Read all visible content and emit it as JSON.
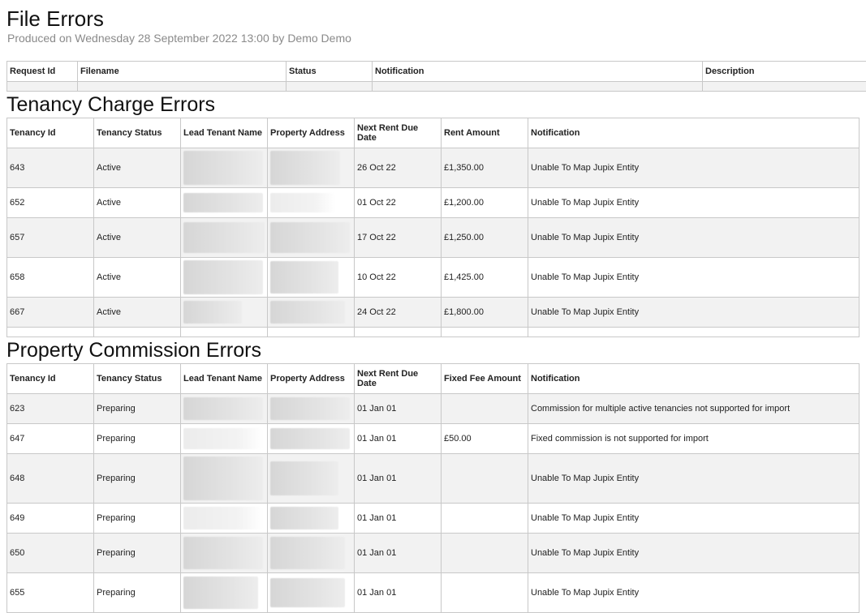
{
  "page": {
    "title": "File Errors",
    "subtitle": "Produced on Wednesday 28 September 2022 13:00 by Demo Demo"
  },
  "file_errors": {
    "columns": [
      "Request Id",
      "Filename",
      "Status",
      "Notification",
      "Description"
    ]
  },
  "tenancy_charge": {
    "title": "Tenancy Charge Errors",
    "columns": [
      "Tenancy Id",
      "Tenancy Status",
      "Lead Tenant Name",
      "Property Address",
      "Next Rent Due Date",
      "Rent Amount",
      "Notification"
    ],
    "rows": [
      {
        "id": "643",
        "status": "Active",
        "due": "26 Oct 22",
        "amount": "£1,350.00",
        "notification": "Unable To Map Jupix Entity"
      },
      {
        "id": "652",
        "status": "Active",
        "due": "01 Oct 22",
        "amount": "£1,200.00",
        "notification": "Unable To Map Jupix Entity"
      },
      {
        "id": "657",
        "status": "Active",
        "due": "17 Oct 22",
        "amount": "£1,250.00",
        "notification": "Unable To Map Jupix Entity"
      },
      {
        "id": "658",
        "status": "Active",
        "due": "10 Oct 22",
        "amount": "£1,425.00",
        "notification": "Unable To Map Jupix Entity"
      },
      {
        "id": "667",
        "status": "Active",
        "due": "24 Oct 22",
        "amount": "£1,800.00",
        "notification": "Unable To Map Jupix Entity"
      }
    ]
  },
  "property_commission": {
    "title": "Property Commission Errors",
    "columns": [
      "Tenancy Id",
      "Tenancy Status",
      "Lead Tenant Name",
      "Property Address",
      "Next Rent Due Date",
      "Fixed Fee Amount",
      "Notification"
    ],
    "rows": [
      {
        "id": "623",
        "status": "Preparing",
        "due": "01 Jan 01",
        "amount": "",
        "notification": "Commission for multiple active tenancies not supported for import"
      },
      {
        "id": "647",
        "status": "Preparing",
        "due": "01 Jan 01",
        "amount": "£50.00",
        "notification": "Fixed commission is not supported for import"
      },
      {
        "id": "648",
        "status": "Preparing",
        "due": "01 Jan 01",
        "amount": "",
        "notification": "Unable To Map Jupix Entity"
      },
      {
        "id": "649",
        "status": "Preparing",
        "due": "01 Jan 01",
        "amount": "",
        "notification": "Unable To Map Jupix Entity"
      },
      {
        "id": "650",
        "status": "Preparing",
        "due": "01 Jan 01",
        "amount": "",
        "notification": "Unable To Map Jupix Entity"
      },
      {
        "id": "655",
        "status": "Preparing",
        "due": "01 Jan 01",
        "amount": "",
        "notification": "Unable To Map Jupix Entity"
      }
    ]
  }
}
